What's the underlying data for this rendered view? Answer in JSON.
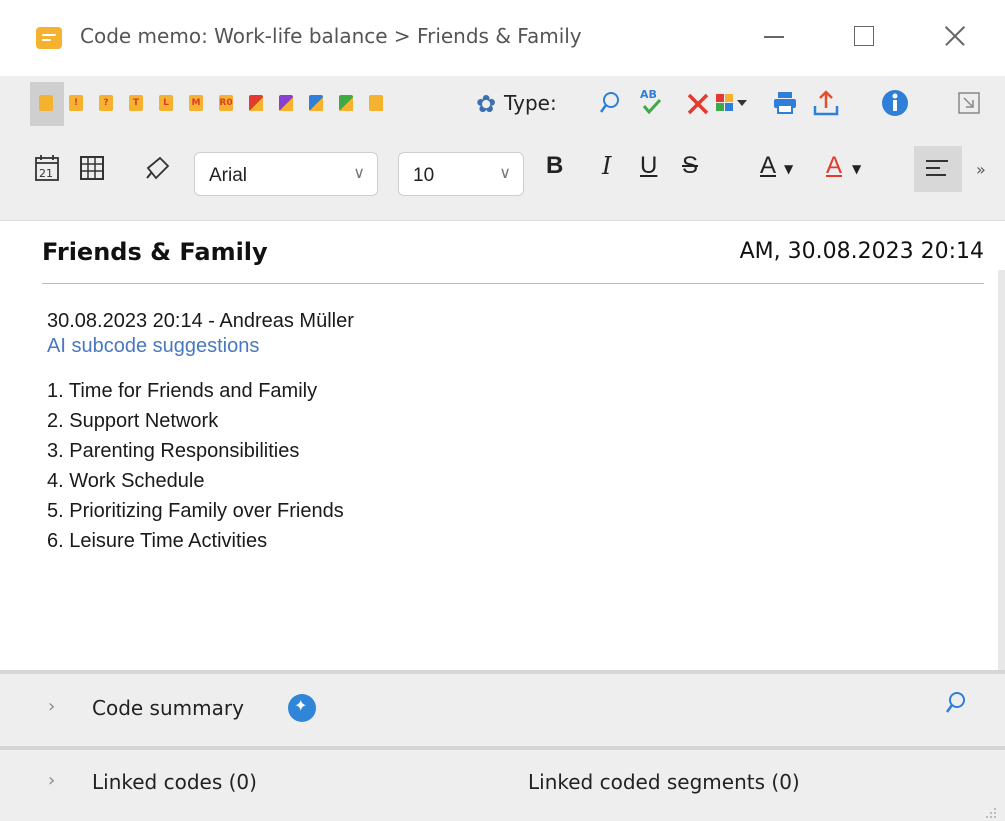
{
  "window": {
    "title": "Code memo: Work-life balance > Friends & Family",
    "minimize_icon": "minimize-icon",
    "maximize_icon": "maximize-icon",
    "close_icon": "close-icon"
  },
  "toolbar1": {
    "memo_markers": [
      {
        "symbol": "",
        "color": "#f5b22e"
      },
      {
        "symbol": "!",
        "color": "#f5b22e"
      },
      {
        "symbol": "?",
        "color": "#f5b22e"
      },
      {
        "symbol": "T",
        "color": "#f5b22e"
      },
      {
        "symbol": "L",
        "color": "#f5b22e"
      },
      {
        "symbol": "M",
        "color": "#f5b22e"
      },
      {
        "symbol": "R0",
        "color": "#f5b22e"
      },
      {
        "symbol": "",
        "color": "#e23a2f"
      },
      {
        "symbol": "",
        "color": "#8a3fd1"
      },
      {
        "symbol": "",
        "color": "#2f7fd8"
      },
      {
        "symbol": "",
        "color": "#3daa45"
      },
      {
        "symbol": "",
        "color": "#f5b22e"
      }
    ],
    "type_label": "Type:",
    "icons": [
      "gear-icon",
      "search-icon",
      "spellcheck-icon",
      "delete-icon",
      "insert-code-icon",
      "print-icon",
      "export-icon",
      "info-icon",
      "undock-icon"
    ]
  },
  "toolbar2": {
    "icons": [
      "insert-date-icon",
      "insert-table-icon",
      "format-painter-icon"
    ],
    "font_family": "Arial",
    "font_size": "10",
    "format_buttons": {
      "bold": "B",
      "italic": "I",
      "underline": "U",
      "strikethrough": "S",
      "font_color": "A",
      "highlight": "A"
    },
    "more": "»"
  },
  "memo": {
    "title": "Friends & Family",
    "meta": "AM, 30.08.2023 20:14",
    "author_line": "30.08.2023 20:14 - Andreas Müller",
    "ai_line": "AI subcode suggestions",
    "list": [
      "1. Time for Friends and Family",
      "2. Support Network",
      "3. Parenting Responsibilities",
      "4. Work Schedule",
      "5. Prioritizing Family over Friends",
      "6. Leisure Time Activities"
    ]
  },
  "sections": {
    "code_summary": "Code summary",
    "linked_codes": "Linked codes (0)",
    "linked_segments": "Linked coded segments (0)"
  },
  "colors": {
    "accent": "#2f86d8",
    "memo_yellow": "#f5b22e",
    "link_blue": "#4a78bf",
    "toolbar_bg": "#eeeeee"
  }
}
